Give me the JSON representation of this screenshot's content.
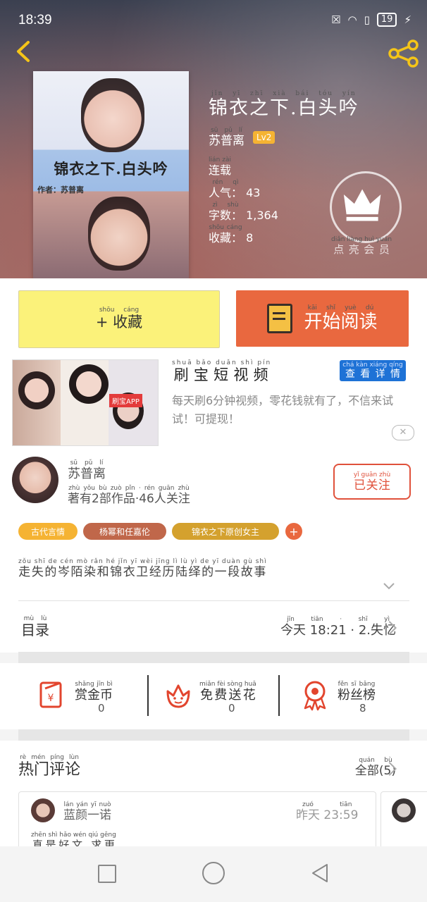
{
  "status_bar": {
    "time": "18:39",
    "battery": "19"
  },
  "book": {
    "cover_title": "锦衣之下.白头吟",
    "cover_author": "作者：苏普离",
    "title": "锦衣之下.白头吟",
    "title_pinyin": "jǐn yī zhī xià bái tóu yín",
    "author": "苏普离",
    "author_pinyin": "sū pǔ lí",
    "level": "Lv2",
    "status": "连载",
    "status_pinyin": "lián zài",
    "popularity_label": "人气：",
    "popularity_pinyin": "rén qì",
    "popularity": "43",
    "word_count_label": "字数：",
    "word_count_pinyin": "zì shù",
    "word_count": "1,364",
    "favorites_label": "收藏：",
    "favorites_pinyin": "shōu cáng",
    "favorites": "8",
    "vip_label": "点亮会员",
    "vip_pinyin": "diǎn liàng huì yuán"
  },
  "actions": {
    "favorite_label": "+ 收藏",
    "favorite_pinyin": "shōu cáng",
    "read_label": "开始阅读",
    "read_pinyin": "kāi shǐ yuè dú"
  },
  "ad": {
    "title": "刷宝短视频",
    "title_pinyin": "shuā bǎo duǎn shì pín",
    "cta": "查看详情",
    "cta_pinyin": "chá kàn xiáng qíng",
    "description": "每天刷6分钟视频，零花钱就有了，不信来试试！可提现！",
    "image_badge": "刷宝APP",
    "close": "✕"
  },
  "author_card": {
    "name": "苏普离",
    "name_pinyin": "sū pǔ lí",
    "stats": "著有2部作品·46人关注",
    "stats_pinyin": "zhù yǒu bù zuò pǐn · rén guān zhù",
    "follow": "已关注",
    "follow_pinyin": "yǐ guān zhù"
  },
  "tags": [
    {
      "label": "古代言情",
      "pinyin": "gǔ dài yán qíng",
      "color": "#f5b333"
    },
    {
      "label": "杨幂和任嘉伦",
      "pinyin": "yáng mì hé rèn jiā lún",
      "color": "#c0674a"
    },
    {
      "label": "锦衣之下原创女主",
      "pinyin": "jǐn yī zhī xià yuán chuàng nǚ zhǔ",
      "color": "#d4a12e"
    }
  ],
  "tag_add": "+",
  "summary": "走失的岑陌染和锦衣卫经历陆绎的一段故事",
  "summary_pinyin": "zǒu shī de cén mò rǎn hé jǐn yī wèi jīng lì lù yì de yī duàn gù shì",
  "toc": {
    "label": "目录",
    "label_pinyin": "mù lù",
    "latest": "今天 18:21 · 2.失忆",
    "latest_pinyin": "jīn tiān · shī yì"
  },
  "stats": [
    {
      "label": "赏金币",
      "pinyin": "shǎng jīn bì",
      "value": "0",
      "icon": "coin-envelope-icon"
    },
    {
      "label": "免费送花",
      "pinyin": "miǎn fèi sòng huā",
      "value": "0",
      "icon": "flower-icon"
    },
    {
      "label": "粉丝榜",
      "pinyin": "fěn sī bǎng",
      "value": "8",
      "icon": "ribbon-icon"
    }
  ],
  "comments": {
    "label": "热门评论",
    "label_pinyin": "rè mén píng lùn",
    "all": "全部(5)",
    "all_pinyin": "quán bù",
    "items": [
      {
        "user": "蓝颜一诺",
        "user_pinyin": "lán yán yī nuò",
        "time": "昨天 23:59",
        "time_pinyin": "zuó tiān",
        "text": "真是好文 求更",
        "text_pinyin": "zhēn shì hǎo wén qiú gēng"
      }
    ]
  },
  "colors": {
    "accent": "#e9683f",
    "favorite_bg": "#fbf27a",
    "follow": "#e0513b",
    "ad_button": "#1e72d6"
  }
}
